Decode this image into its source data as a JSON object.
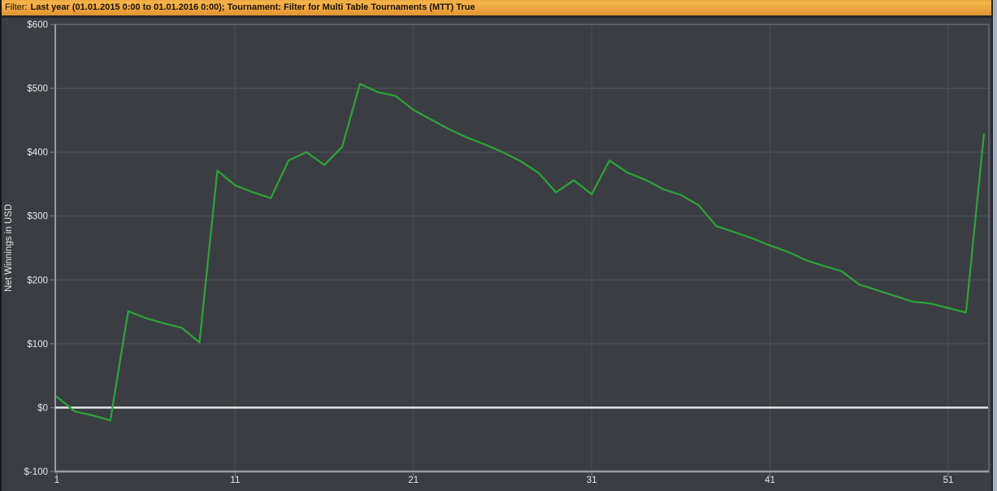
{
  "filter_bar": {
    "label": "Filter:",
    "criteria": "Last year (01.01.2015 0:00 to 01.01.2016 0:00); Tournament: Filter for Multi Table Tournaments (MTT) True"
  },
  "colors": {
    "window_background": "#3a3e43",
    "plot_background": "#3a3e43",
    "filter_bar_orange_top": "#f4b54b",
    "filter_bar_orange_bottom": "#de9530",
    "filter_text": "#1b1306",
    "axis_border": "#7e8286",
    "axis_strong": "#9a9da1",
    "gridline_horizontal": "#51555a",
    "gridline_vertical": "#4b4f54",
    "zero_line": "#e2e4e6",
    "series_line": "#2ca23c",
    "tick_text": "#e5e7e9",
    "window_left_border": "#15171a",
    "window_right_strip": "#a2b2c6"
  },
  "chart_data": {
    "type": "line",
    "title": "",
    "xlabel": "",
    "ylabel": "Net Winnings in USD",
    "ylim": [
      -100,
      600
    ],
    "xlim": [
      1,
      53.4
    ],
    "grid": true,
    "legend_position": "none",
    "zero_line_value": 0,
    "x_ticks": [
      {
        "value": 1,
        "label": "1"
      },
      {
        "value": 11,
        "label": "11"
      },
      {
        "value": 21,
        "label": "21"
      },
      {
        "value": 31,
        "label": "31"
      },
      {
        "value": 41,
        "label": "41"
      },
      {
        "value": 51,
        "label": "51"
      }
    ],
    "y_ticks": [
      {
        "value": 600,
        "label": "$600"
      },
      {
        "value": 500,
        "label": "$500"
      },
      {
        "value": 400,
        "label": "$400"
      },
      {
        "value": 300,
        "label": "$300"
      },
      {
        "value": 200,
        "label": "$200"
      },
      {
        "value": 100,
        "label": "$100"
      },
      {
        "value": 0,
        "label": "$0"
      },
      {
        "value": -100,
        "label": "$-100"
      }
    ],
    "series": [
      {
        "name": "Net Winnings in USD",
        "color": "#2ca23c",
        "x": [
          1,
          2,
          3,
          4,
          5,
          6,
          7,
          8,
          9,
          10,
          11,
          12,
          13,
          14,
          15,
          16,
          17,
          18,
          19,
          20,
          21,
          22,
          23,
          24,
          25,
          26,
          27,
          28,
          29,
          30,
          31,
          32,
          33,
          34,
          35,
          36,
          37,
          38,
          39,
          40,
          41,
          42,
          43,
          44,
          45,
          46,
          47,
          48,
          49,
          50,
          51,
          52,
          53
        ],
        "values": [
          17,
          -6,
          -12,
          -20,
          151,
          140,
          132,
          125,
          102,
          371,
          348,
          337,
          328,
          387,
          400,
          380,
          408,
          507,
          494,
          488,
          466,
          451,
          436,
          423,
          412,
          400,
          386,
          368,
          337,
          356,
          334,
          387,
          368,
          357,
          342,
          333,
          317,
          284,
          275,
          265,
          254,
          244,
          231,
          222,
          214,
          193,
          184,
          175,
          166,
          163,
          156,
          149,
          428
        ]
      }
    ]
  }
}
